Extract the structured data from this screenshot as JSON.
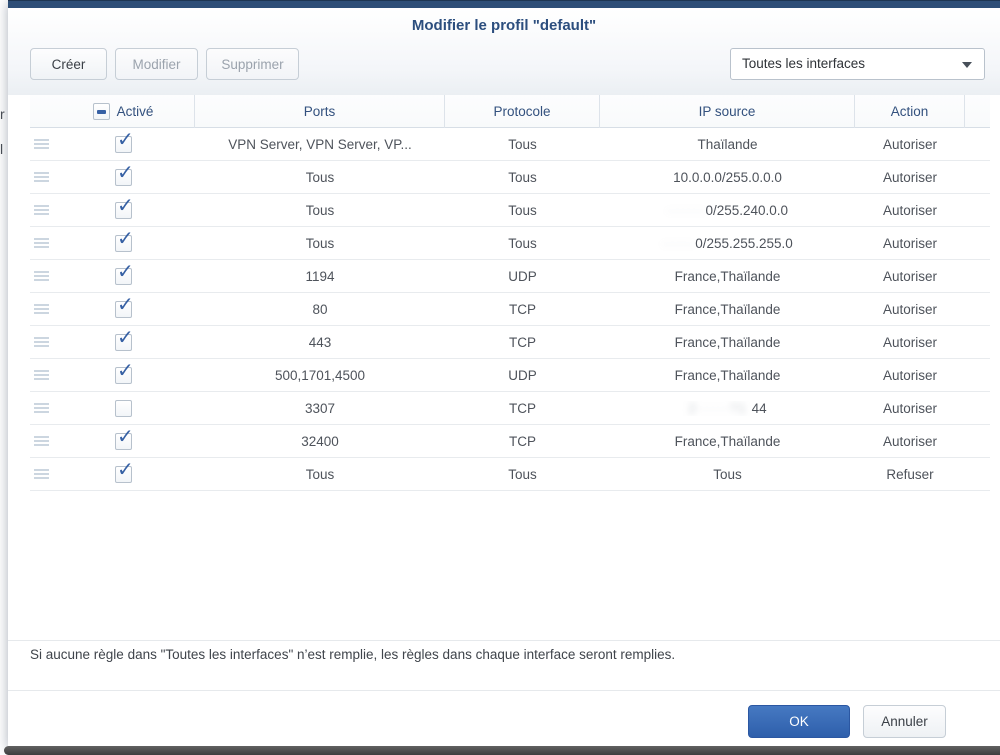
{
  "window": {
    "title": "Modifier le profil \"default\""
  },
  "toolbar": {
    "create": "Créer",
    "modify": "Modifier",
    "delete": "Supprimer",
    "interface_dropdown": {
      "value": "Toutes les interfaces"
    }
  },
  "table": {
    "header": {
      "enabled": "Activé",
      "ports": "Ports",
      "protocol": "Protocole",
      "source_ip": "IP source",
      "action": "Action"
    },
    "rows": [
      {
        "enabled": true,
        "ports": "VPN Server, VPN Server, VP...",
        "protocol": "Tous",
        "source_ip": [
          {
            "text": "Thaïlande",
            "redacted": false
          }
        ],
        "action": "Autoriser"
      },
      {
        "enabled": true,
        "ports": "Tous",
        "protocol": "Tous",
        "source_ip": [
          {
            "text": "10.0.0.0/255.0.0.0",
            "redacted": false
          }
        ],
        "action": "Autoriser"
      },
      {
        "enabled": true,
        "ports": "Tous",
        "protocol": "Tous",
        "source_ip": [
          {
            "text": "·······",
            "redacted": true
          },
          {
            "text": "0/255.240.0.0",
            "redacted": false
          }
        ],
        "action": "Autoriser"
      },
      {
        "enabled": true,
        "ports": "Tous",
        "protocol": "Tous",
        "source_ip": [
          {
            "text": "······",
            "redacted": true
          },
          {
            "text": "0/255.255.255.0",
            "redacted": false
          }
        ],
        "action": "Autoriser"
      },
      {
        "enabled": true,
        "ports": "1194",
        "protocol": "UDP",
        "source_ip": [
          {
            "text": "France,Thaïlande",
            "redacted": false
          }
        ],
        "action": "Autoriser"
      },
      {
        "enabled": true,
        "ports": "80",
        "protocol": "TCP",
        "source_ip": [
          {
            "text": "France,Thaïlande",
            "redacted": false
          }
        ],
        "action": "Autoriser"
      },
      {
        "enabled": true,
        "ports": "443",
        "protocol": "TCP",
        "source_ip": [
          {
            "text": "France,Thaïlande",
            "redacted": false
          }
        ],
        "action": "Autoriser"
      },
      {
        "enabled": true,
        "ports": "500,1701,4500",
        "protocol": "UDP",
        "source_ip": [
          {
            "text": "France,Thaïlande",
            "redacted": false
          }
        ],
        "action": "Autoriser"
      },
      {
        "enabled": false,
        "ports": "3307",
        "protocol": "TCP",
        "source_ip": [
          {
            "text": "2······?1 ",
            "redacted": true
          },
          {
            "text": "44",
            "redacted": false
          }
        ],
        "action": "Autoriser"
      },
      {
        "enabled": true,
        "ports": "32400",
        "protocol": "TCP",
        "source_ip": [
          {
            "text": "France,Thaïlande",
            "redacted": false
          }
        ],
        "action": "Autoriser"
      },
      {
        "enabled": true,
        "ports": "Tous",
        "protocol": "Tous",
        "source_ip": [
          {
            "text": "Tous",
            "redacted": false
          }
        ],
        "action": "Refuser"
      }
    ]
  },
  "footer": {
    "note": "Si aucune règle dans \"Toutes les interfaces\" n’est remplie, les règles dans chaque interface seront remplies.",
    "ok": "OK",
    "cancel": "Annuler"
  },
  "icons": {
    "check": "✓"
  },
  "colors": {
    "titlebar": "#2e4e77",
    "title_text": "#2c4e7e",
    "header_text": "#33517e",
    "check_blue": "#3660a4",
    "ok_button": "#2e5fab",
    "bottom_bar": "#4a4a4a"
  },
  "background": {
    "left_fragments": [
      "r",
      "l"
    ]
  }
}
